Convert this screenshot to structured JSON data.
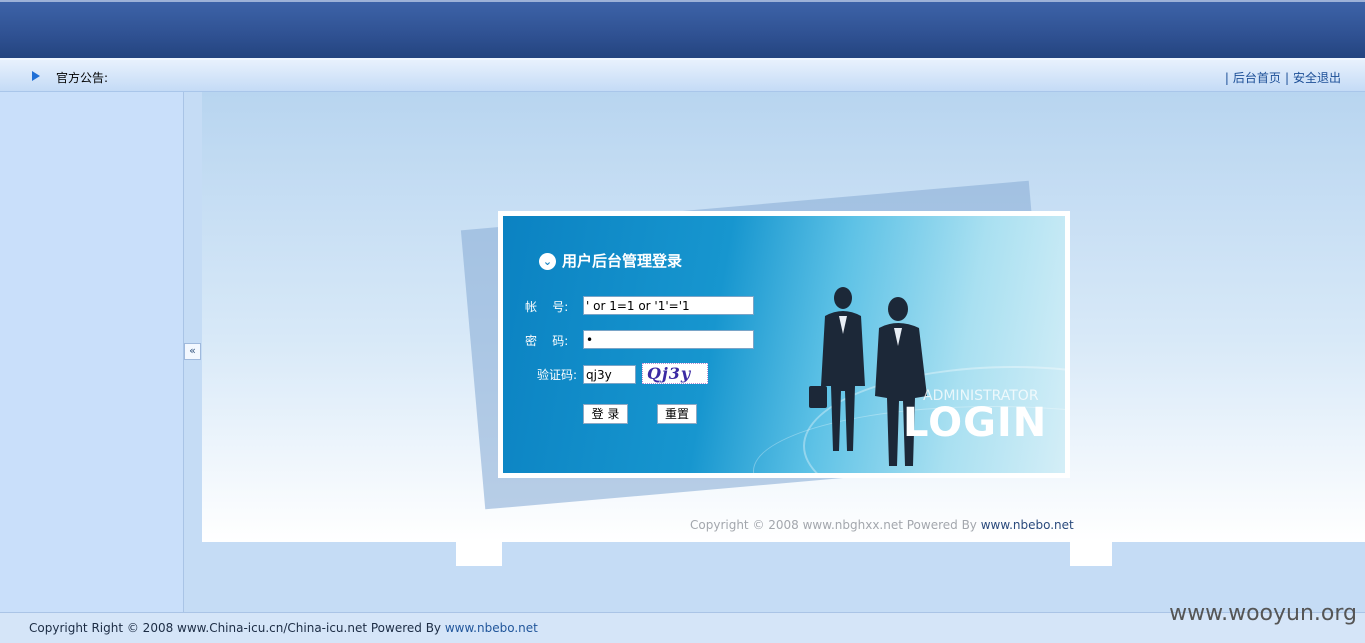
{
  "header": {
    "notice_label": "官方公告:",
    "links": [
      {
        "label": "后台首页"
      },
      {
        "label": "安全退出"
      }
    ],
    "separator": "|"
  },
  "sidebar": {
    "collapse_label": "«"
  },
  "login": {
    "title": "用户后台管理登录",
    "title_icon": "chevron-down-icon",
    "account_label": "帐    号:",
    "account_value": "' or 1=1 or '1'='1",
    "password_label": "密    码:",
    "password_value": "•",
    "captcha_label": "验证码:",
    "captcha_value": "qj3y",
    "captcha_image_text": "Qj3y",
    "submit_label": "登 录",
    "reset_label": "重置",
    "brand_sub": "ADMINISTRATOR",
    "brand_main": "LOGIN"
  },
  "inner_copyright": {
    "text": "Copyright © 2008 www.nbghxx.net Powered By ",
    "link": "www.nbebo.net"
  },
  "footer": {
    "text": "Copyright Right © 2008 www.China-icu.cn/China-icu.net Powered By ",
    "link": "www.nbebo.net"
  },
  "watermark": "www.wooyun.org",
  "colors": {
    "topbar": "#2f5192",
    "panel_blue": "#1796cf",
    "link": "#1c4f97"
  }
}
